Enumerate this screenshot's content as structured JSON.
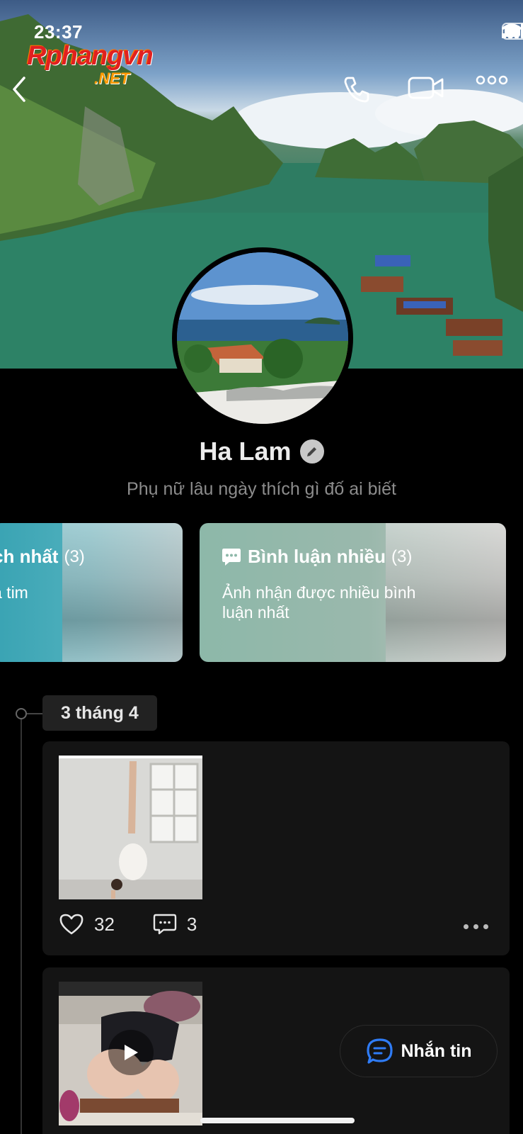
{
  "status_bar": {
    "time": "23:37"
  },
  "watermark": {
    "main": "Rphangvn",
    "sub": ".NET"
  },
  "header": {
    "back_icon": "chevron-left-icon",
    "call_icon": "phone-icon",
    "video_icon": "video-icon",
    "more_icon": "more-horizontal-icon"
  },
  "profile": {
    "name": "Ha Lam",
    "bio": "Phụ nữ lâu ngày thích gì đố ai biết",
    "edit_icon": "pencil-icon"
  },
  "highlights": [
    {
      "title": "ch nhất",
      "count": "(3)",
      "desc": "ả tim"
    },
    {
      "title": "Bình luận nhiều",
      "count": "(3)",
      "desc": "Ảnh nhận được nhiều bình luận nhất",
      "icon": "comment-bubble-icon"
    }
  ],
  "timeline": {
    "date_label": "3 tháng 4",
    "posts": [
      {
        "likes": "32",
        "comments": "3",
        "type": "photo"
      },
      {
        "type": "video"
      }
    ]
  },
  "message_button": {
    "label": "Nhắn tin",
    "icon": "chat-icon"
  },
  "colors": {
    "background": "#000000",
    "card_bg": "#141414",
    "accent_blue": "#2f7cf6"
  }
}
